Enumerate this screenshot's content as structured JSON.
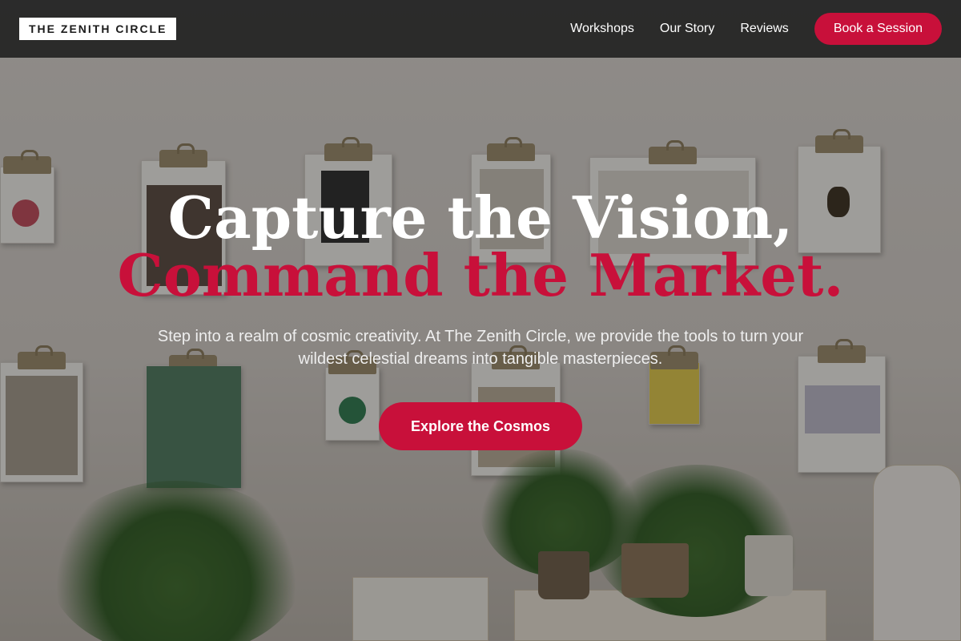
{
  "brand": {
    "logo": "THE ZENITH CIRCLE"
  },
  "nav": {
    "links": [
      "Workshops",
      "Our Story",
      "Reviews"
    ],
    "cta": "Book a Session"
  },
  "hero": {
    "headline_line1": "Capture the Vision,",
    "headline_line2": "Command the Market.",
    "subtitle": "Step into a realm of cosmic creativity. At The Zenith Circle, we provide the tools to turn your wildest celestial dreams into tangible masterpieces.",
    "cta": "Explore the Cosmos",
    "background_image": "clipboards-on-wall-photo"
  },
  "colors": {
    "accent": "#c8103a",
    "header_bg": "#1e1e1e",
    "text_light": "#ffffff"
  }
}
